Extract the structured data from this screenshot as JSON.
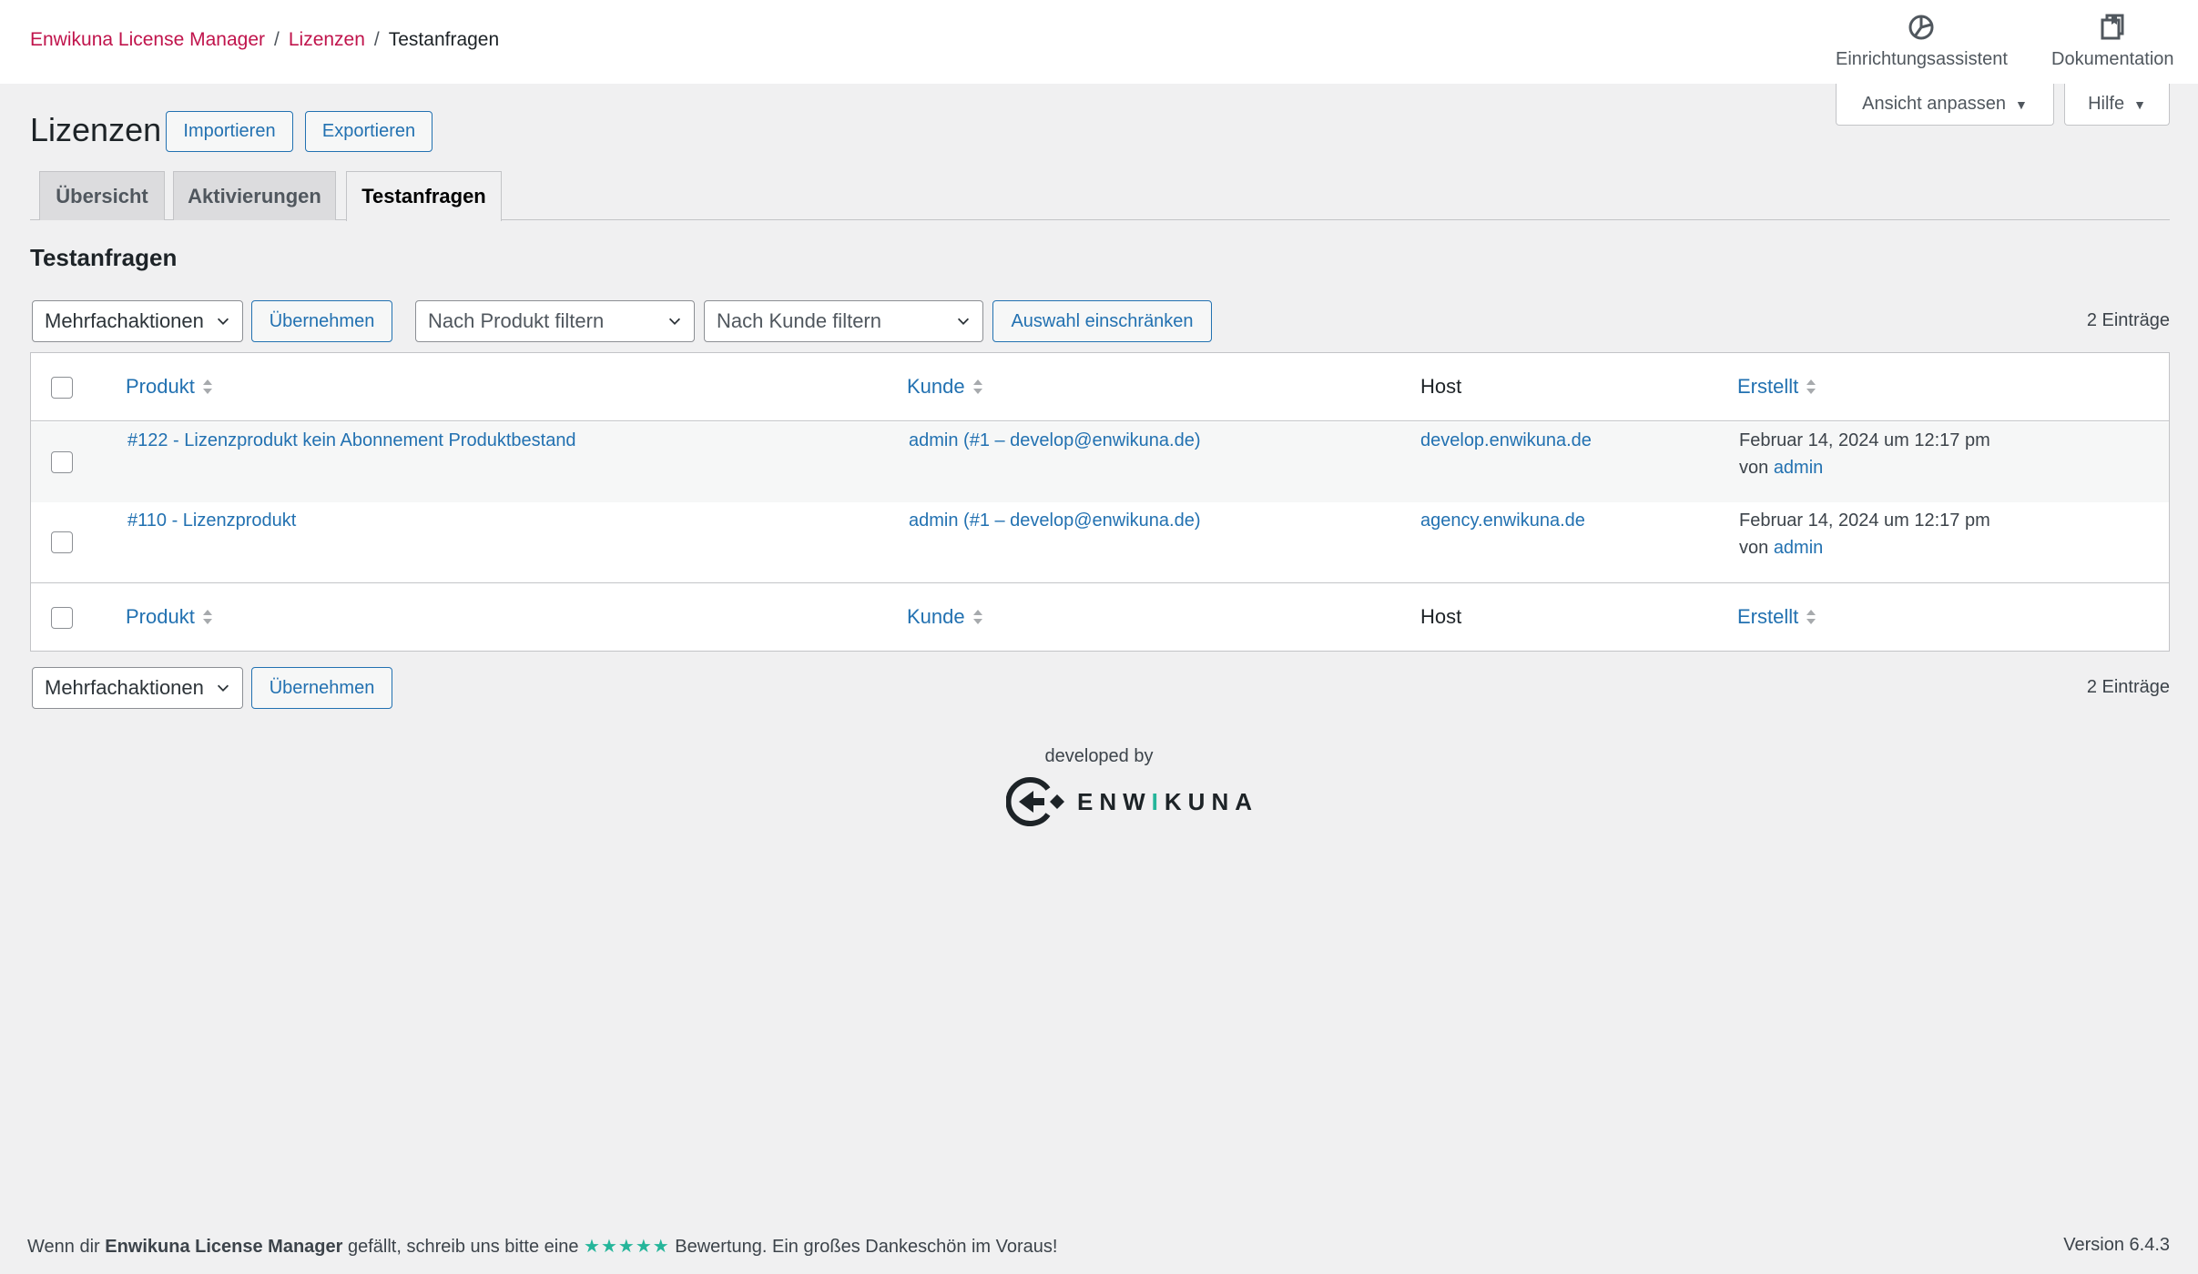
{
  "breadcrumb": {
    "root": "Enwikuna License Manager",
    "section": "Lizenzen",
    "current": "Testanfragen",
    "separator": "/"
  },
  "toplinks": {
    "setup": "Einrichtungsassistent",
    "docs": "Dokumentation"
  },
  "screen_meta": {
    "options": "Ansicht anpassen",
    "help": "Hilfe"
  },
  "page": {
    "title": "Lizenzen",
    "import": "Importieren",
    "export": "Exportieren"
  },
  "tabs": [
    {
      "label": "Übersicht",
      "active": false
    },
    {
      "label": "Aktivierungen",
      "active": false
    },
    {
      "label": "Testanfragen",
      "active": true
    }
  ],
  "section_title": "Testanfragen",
  "tablenav_top": {
    "bulk_action": "Mehrfachaktionen",
    "apply": "Übernehmen",
    "product_filter": "Nach Produkt filtern",
    "customer_filter": "Nach Kunde filtern",
    "filter_button": "Auswahl einschränken",
    "count": "2 Einträge"
  },
  "columns": {
    "product": "Produkt",
    "customer": "Kunde",
    "host": "Host",
    "created": "Erstellt"
  },
  "rows": [
    {
      "product": "#122 - Lizenzprodukt kein Abonnement Produktbestand",
      "customer": "admin (#1 – develop@enwikuna.de)",
      "host": "develop.enwikuna.de",
      "created": "Februar 14, 2024 um 12:17 pm",
      "by_label": "von",
      "by_user": "admin"
    },
    {
      "product": "#110 - Lizenzprodukt",
      "customer": "admin (#1 – develop@enwikuna.de)",
      "host": "agency.enwikuna.de",
      "created": "Februar 14, 2024 um 12:17 pm",
      "by_label": "von",
      "by_user": "admin"
    }
  ],
  "tablenav_bottom": {
    "bulk_action": "Mehrfachaktionen",
    "apply": "Übernehmen",
    "count": "2 Einträge"
  },
  "brand": {
    "developed_by": "developed by",
    "word_start": "ENW",
    "word_accent": "I",
    "word_end": "KUNA"
  },
  "footer": {
    "text_before": "Wenn dir ",
    "plugin_name": "Enwikuna License Manager",
    "text_middle": " gefällt, schreib uns bitte eine ",
    "stars": "★★★★★",
    "text_after": " Bewertung. Ein großes Dankeschön im Voraus!",
    "version": "Version 6.4.3"
  },
  "colors": {
    "accent_link": "#2271b1",
    "breadcrumb": "#c0144c",
    "brand_accent": "#25b59a"
  }
}
